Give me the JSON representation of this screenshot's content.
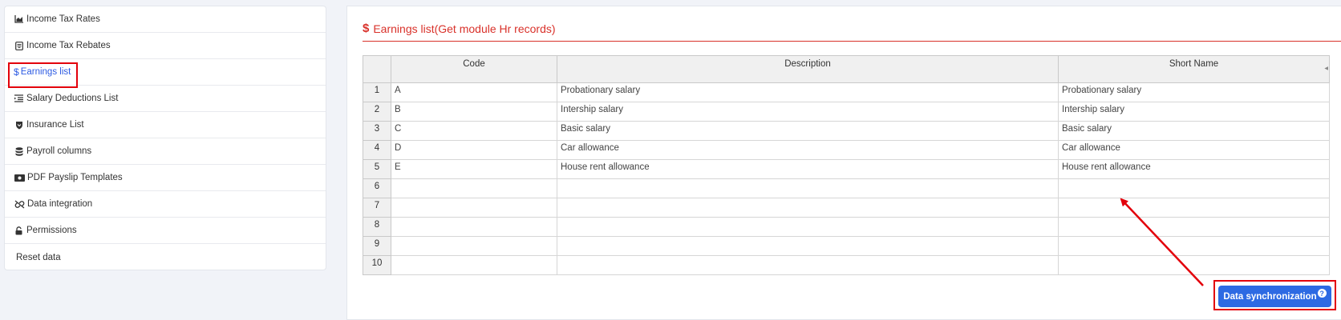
{
  "sidebar": {
    "items": [
      {
        "label": "Income Tax Rates",
        "icon": "chart-area-icon"
      },
      {
        "label": "Income Tax Rebates",
        "icon": "receipt-icon"
      },
      {
        "label": "Earnings list",
        "icon": "dollar-icon",
        "active": true
      },
      {
        "label": "Salary Deductions List",
        "icon": "list-indent-icon"
      },
      {
        "label": "Insurance List",
        "icon": "shield-icon"
      },
      {
        "label": "Payroll columns",
        "icon": "database-icon"
      },
      {
        "label": "PDF Payslip Templates",
        "icon": "money-bill-icon"
      },
      {
        "label": "Data integration",
        "icon": "unlink-icon"
      },
      {
        "label": "Permissions",
        "icon": "lock-icon"
      },
      {
        "label": "Reset data",
        "icon": ""
      }
    ]
  },
  "main": {
    "title": "Earnings list(Get module Hr records)",
    "title_icon": "$"
  },
  "table": {
    "headers": {
      "code": "Code",
      "description": "Description",
      "short_name": "Short Name"
    },
    "rows": [
      {
        "n": "1",
        "code": "A",
        "description": "Probationary salary",
        "short_name": "Probationary salary"
      },
      {
        "n": "2",
        "code": "B",
        "description": "Intership salary",
        "short_name": "Intership salary"
      },
      {
        "n": "3",
        "code": "C",
        "description": "Basic salary",
        "short_name": "Basic salary"
      },
      {
        "n": "4",
        "code": "D",
        "description": "Car allowance",
        "short_name": "Car allowance"
      },
      {
        "n": "5",
        "code": "E",
        "description": "House rent allowance",
        "short_name": "House rent allowance"
      },
      {
        "n": "6",
        "code": "",
        "description": "",
        "short_name": ""
      },
      {
        "n": "7",
        "code": "",
        "description": "",
        "short_name": ""
      },
      {
        "n": "8",
        "code": "",
        "description": "",
        "short_name": ""
      },
      {
        "n": "9",
        "code": "",
        "description": "",
        "short_name": ""
      },
      {
        "n": "10",
        "code": "",
        "description": "",
        "short_name": ""
      }
    ]
  },
  "actions": {
    "sync_label": "Data synchronization",
    "help_glyph": "?"
  },
  "colors": {
    "accent": "#2d6ae3",
    "title": "#d9312a",
    "highlight": "#e3000b"
  }
}
